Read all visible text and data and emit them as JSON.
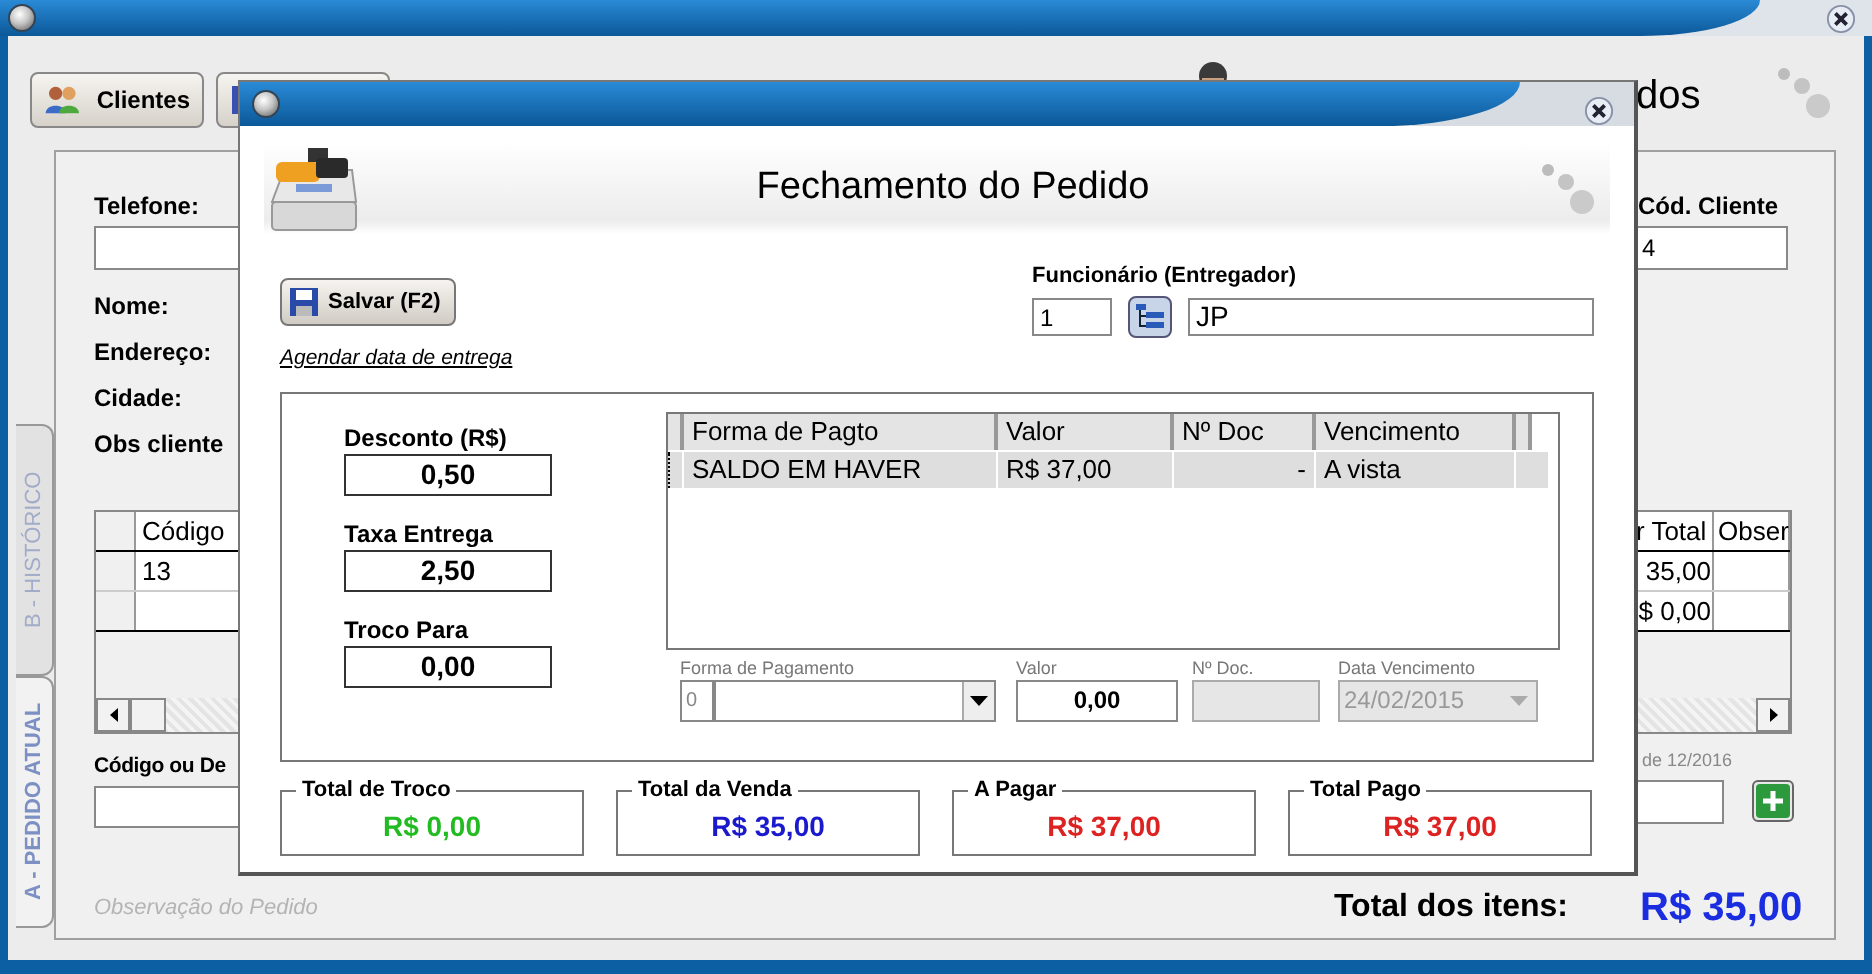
{
  "main_window": {
    "toolbar": [
      {
        "kind": "labeled",
        "label": "Clientes"
      },
      {
        "kind": "icon_only"
      }
    ],
    "heading": "dos",
    "tabs": [
      {
        "label": "B - HISTÓRICO",
        "selected": false
      },
      {
        "label": "A - PEDIDO ATUAL",
        "selected": true
      }
    ],
    "customer": [
      {
        "kind": "input",
        "label": "Telefone:"
      },
      {
        "kind": "text",
        "label": "Nome:"
      },
      {
        "kind": "text",
        "label": "Endereço:"
      },
      {
        "kind": "text",
        "label": "Cidade:"
      },
      {
        "kind": "text",
        "label": "Obs cliente"
      }
    ],
    "client_code": {
      "label": "Cód. Cliente",
      "value": "4"
    },
    "items": {
      "left_columns": [
        "Código"
      ],
      "right_columns": [
        "r Total",
        "Obser"
      ],
      "rows": [
        {
          "code": "13",
          "total": "35,00"
        },
        {
          "total": "$ 0,00"
        }
      ]
    },
    "product_search": {
      "label": "Código ou De",
      "hint": "de 12/2016"
    },
    "notes_placeholder": "Observação do Pedido",
    "total": {
      "label": "Total dos itens:",
      "value": "R$ 35,00"
    }
  },
  "dialog": {
    "title": "Fechamento do Pedido",
    "save_button": "Salvar (F2)",
    "employee": {
      "label": "Funcionário (Entregador)",
      "code": "1",
      "name": "JP"
    },
    "schedule_link": "Agendar data de entrega",
    "adjustments": [
      {
        "label": "Desconto (R$)",
        "value": "0,50"
      },
      {
        "label": "Taxa Entrega",
        "value": "2,50"
      },
      {
        "label": "Troco Para",
        "value": "0,00"
      }
    ],
    "payments": {
      "columns": [
        "Forma de Pagto",
        "Valor",
        "Nº Doc",
        "Vencimento"
      ],
      "rows": [
        {
          "method": "SALDO EM HAVER",
          "amount": "R$ 37,00",
          "doc": "-",
          "due": "A vista",
          "selected": true
        }
      ]
    },
    "entry": [
      {
        "kind": "select_code",
        "label": "Forma de Pagamento",
        "code": "0",
        "disabled": false
      },
      {
        "kind": "input",
        "label": "Valor",
        "value": "0,00",
        "disabled": false
      },
      {
        "kind": "input",
        "label": "Nº Doc.",
        "disabled": true
      },
      {
        "kind": "select",
        "label": "Data Vencimento",
        "value": "24/02/2015",
        "disabled": true
      }
    ],
    "totals": [
      {
        "label": "Total de Troco",
        "value": "R$ 0,00",
        "color": "#22bb22"
      },
      {
        "label": "Total da Venda",
        "value": "R$ 35,00",
        "color": "#1a1acc"
      },
      {
        "label": "A Pagar",
        "value": "R$ 37,00",
        "color": "#dd2222"
      },
      {
        "label": "Total Pago",
        "value": "R$ 37,00",
        "color": "#dd2222"
      }
    ]
  }
}
